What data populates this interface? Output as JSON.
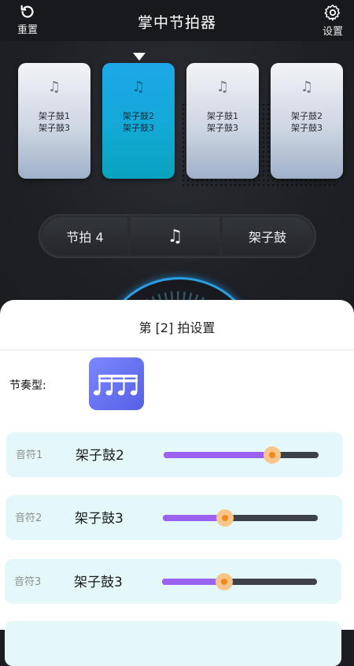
{
  "topbar": {
    "title": "掌中节拍器",
    "reset_label": "重置",
    "settings_label": "设置"
  },
  "beats": [
    {
      "note": "♫",
      "line1": "架子鼓1",
      "line2": "架子鼓3",
      "active": false
    },
    {
      "note": "♫",
      "line1": "架子鼓2",
      "line2": "架子鼓3",
      "active": true
    },
    {
      "note": "♫",
      "line1": "架子鼓1",
      "line2": "架子鼓3",
      "active": false
    },
    {
      "note": "♫",
      "line1": "架子鼓2",
      "line2": "架子鼓3",
      "active": false
    }
  ],
  "controls": {
    "beat_label": "节拍 4",
    "note_icon": "♫",
    "instrument_label": "架子鼓"
  },
  "sheet": {
    "title": "第 [2] 拍设置",
    "rhythm_label": "节奏型:",
    "notes": [
      {
        "label": "音符1",
        "instrument": "架子鼓2",
        "level": 0.7
      },
      {
        "label": "音符2",
        "instrument": "架子鼓3",
        "level": 0.4
      },
      {
        "label": "音符3",
        "instrument": "架子鼓3",
        "level": 0.4
      }
    ]
  },
  "colors": {
    "accent_blue": "#1da7e9",
    "slider_fill": "#9b61ef",
    "slider_thumb": "#f7c58a",
    "row_bg": "#e4f8fa"
  },
  "icons": {
    "reset": "refresh-icon",
    "settings": "gear-icon",
    "rhythm": "sixteenth-notes-icon"
  }
}
